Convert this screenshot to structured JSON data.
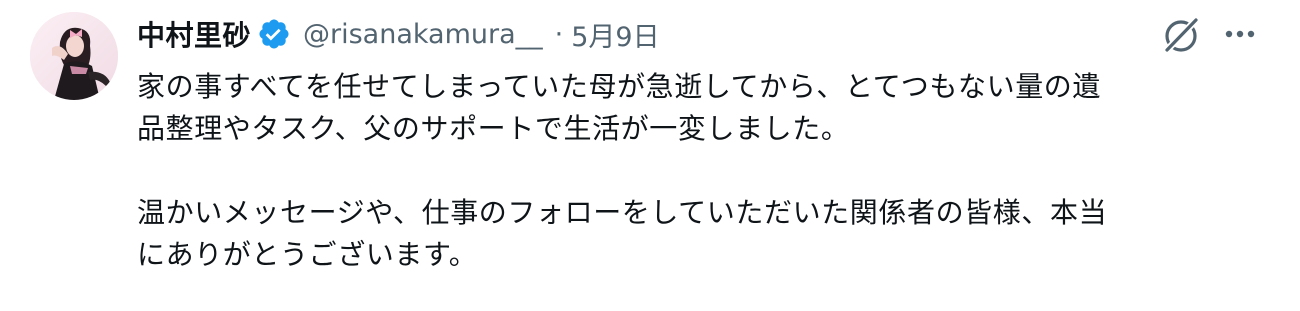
{
  "author": {
    "display_name": "中村里砂",
    "handle": "@risanakamura__",
    "separator": "·",
    "date": "5月9日",
    "verified": true
  },
  "icons": {
    "avatar": "profile-photo",
    "verified": "verified-badge-icon",
    "grok": "grok-icon",
    "more": "more-horizontal-icon"
  },
  "colors": {
    "text": "#0f1419",
    "secondary": "#536471",
    "verified": "#1d9bf0"
  },
  "tweet": {
    "line1": "家の事すべてを任せてしまっていた母が急逝してから、とてつもない量の遺",
    "line2": "品整理やタスク、父のサポートで生活が一変しました。",
    "line3": "温かいメッセージや、仕事のフォローをしていただいた関係者の皆様、本当",
    "line4": "にありがとうございます。"
  }
}
